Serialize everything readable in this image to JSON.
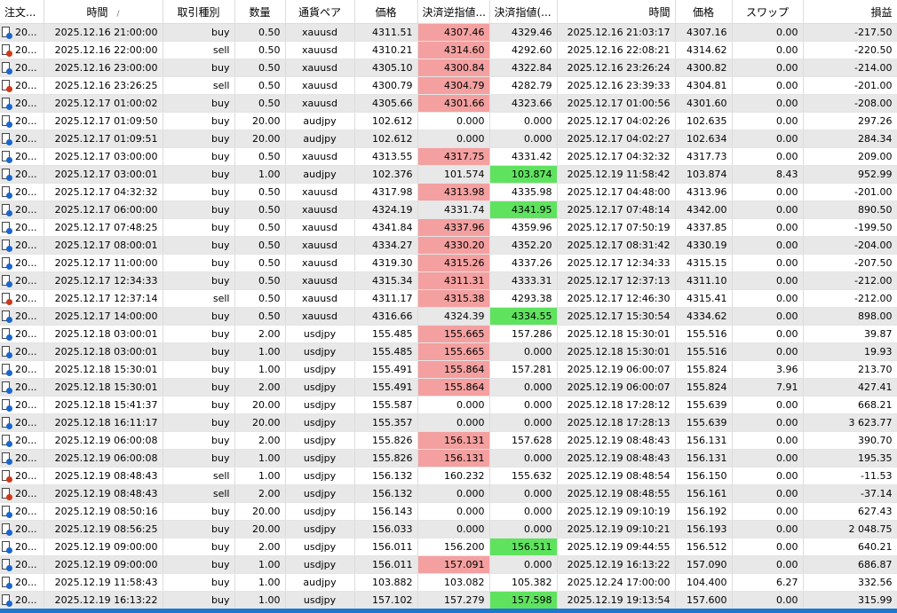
{
  "headers": [
    "注文...",
    "時間",
    "取引種別",
    "数量",
    "通貨ペア",
    "価格",
    "決済逆指値...",
    "決済指値(...",
    "時間",
    "価格",
    "スワップ",
    "損益"
  ],
  "sort_indicator": "/",
  "colors": {
    "stop_hit": "#f4a0a0",
    "tp_hit": "#5fe35f",
    "alt_row": "#e8e8e8",
    "selection": "#1e78d0"
  },
  "rows": [
    {
      "id": "20...",
      "open_time": "2025.12.16 21:00:00",
      "type": "buy",
      "volume": "0.50",
      "symbol": "xauusd",
      "open_price": "4311.51",
      "sl": "4307.46",
      "tp": "4329.46",
      "close_time": "2025.12.16 21:03:17",
      "close_price": "4307.16",
      "swap": "0.00",
      "profit": "-217.50",
      "hl": "sl"
    },
    {
      "id": "20...",
      "open_time": "2025.12.16 22:00:00",
      "type": "sell",
      "volume": "0.50",
      "symbol": "xauusd",
      "open_price": "4310.21",
      "sl": "4314.60",
      "tp": "4292.60",
      "close_time": "2025.12.16 22:08:21",
      "close_price": "4314.62",
      "swap": "0.00",
      "profit": "-220.50",
      "hl": "sl"
    },
    {
      "id": "20...",
      "open_time": "2025.12.16 23:00:00",
      "type": "buy",
      "volume": "0.50",
      "symbol": "xauusd",
      "open_price": "4305.10",
      "sl": "4300.84",
      "tp": "4322.84",
      "close_time": "2025.12.16 23:26:24",
      "close_price": "4300.82",
      "swap": "0.00",
      "profit": "-214.00",
      "hl": "sl"
    },
    {
      "id": "20...",
      "open_time": "2025.12.16 23:26:25",
      "type": "sell",
      "volume": "0.50",
      "symbol": "xauusd",
      "open_price": "4300.79",
      "sl": "4304.79",
      "tp": "4282.79",
      "close_time": "2025.12.16 23:39:33",
      "close_price": "4304.81",
      "swap": "0.00",
      "profit": "-201.00",
      "hl": "sl"
    },
    {
      "id": "20...",
      "open_time": "2025.12.17 01:00:02",
      "type": "buy",
      "volume": "0.50",
      "symbol": "xauusd",
      "open_price": "4305.66",
      "sl": "4301.66",
      "tp": "4323.66",
      "close_time": "2025.12.17 01:00:56",
      "close_price": "4301.60",
      "swap": "0.00",
      "profit": "-208.00",
      "hl": "sl"
    },
    {
      "id": "20...",
      "open_time": "2025.12.17 01:09:50",
      "type": "buy",
      "volume": "20.00",
      "symbol": "audjpy",
      "open_price": "102.612",
      "sl": "0.000",
      "tp": "0.000",
      "close_time": "2025.12.17 04:02:26",
      "close_price": "102.635",
      "swap": "0.00",
      "profit": "297.26",
      "hl": ""
    },
    {
      "id": "20...",
      "open_time": "2025.12.17 01:09:51",
      "type": "buy",
      "volume": "20.00",
      "symbol": "audjpy",
      "open_price": "102.612",
      "sl": "0.000",
      "tp": "0.000",
      "close_time": "2025.12.17 04:02:27",
      "close_price": "102.634",
      "swap": "0.00",
      "profit": "284.34",
      "hl": ""
    },
    {
      "id": "20...",
      "open_time": "2025.12.17 03:00:00",
      "type": "buy",
      "volume": "0.50",
      "symbol": "xauusd",
      "open_price": "4313.55",
      "sl": "4317.75",
      "tp": "4331.42",
      "close_time": "2025.12.17 04:32:32",
      "close_price": "4317.73",
      "swap": "0.00",
      "profit": "209.00",
      "hl": "sl"
    },
    {
      "id": "20...",
      "open_time": "2025.12.17 03:00:01",
      "type": "buy",
      "volume": "1.00",
      "symbol": "audjpy",
      "open_price": "102.376",
      "sl": "101.574",
      "tp": "103.874",
      "close_time": "2025.12.19 11:58:42",
      "close_price": "103.874",
      "swap": "8.43",
      "profit": "952.99",
      "hl": "tp"
    },
    {
      "id": "20...",
      "open_time": "2025.12.17 04:32:32",
      "type": "buy",
      "volume": "0.50",
      "symbol": "xauusd",
      "open_price": "4317.98",
      "sl": "4313.98",
      "tp": "4335.98",
      "close_time": "2025.12.17 04:48:00",
      "close_price": "4313.96",
      "swap": "0.00",
      "profit": "-201.00",
      "hl": "sl"
    },
    {
      "id": "20...",
      "open_time": "2025.12.17 06:00:00",
      "type": "buy",
      "volume": "0.50",
      "symbol": "xauusd",
      "open_price": "4324.19",
      "sl": "4331.74",
      "tp": "4341.95",
      "close_time": "2025.12.17 07:48:14",
      "close_price": "4342.00",
      "swap": "0.00",
      "profit": "890.50",
      "hl": "tp"
    },
    {
      "id": "20...",
      "open_time": "2025.12.17 07:48:25",
      "type": "buy",
      "volume": "0.50",
      "symbol": "xauusd",
      "open_price": "4341.84",
      "sl": "4337.96",
      "tp": "4359.96",
      "close_time": "2025.12.17 07:50:19",
      "close_price": "4337.85",
      "swap": "0.00",
      "profit": "-199.50",
      "hl": "sl"
    },
    {
      "id": "20...",
      "open_time": "2025.12.17 08:00:01",
      "type": "buy",
      "volume": "0.50",
      "symbol": "xauusd",
      "open_price": "4334.27",
      "sl": "4330.20",
      "tp": "4352.20",
      "close_time": "2025.12.17 08:31:42",
      "close_price": "4330.19",
      "swap": "0.00",
      "profit": "-204.00",
      "hl": "sl"
    },
    {
      "id": "20...",
      "open_time": "2025.12.17 11:00:00",
      "type": "buy",
      "volume": "0.50",
      "symbol": "xauusd",
      "open_price": "4319.30",
      "sl": "4315.26",
      "tp": "4337.26",
      "close_time": "2025.12.17 12:34:33",
      "close_price": "4315.15",
      "swap": "0.00",
      "profit": "-207.50",
      "hl": "sl"
    },
    {
      "id": "20...",
      "open_time": "2025.12.17 12:34:33",
      "type": "buy",
      "volume": "0.50",
      "symbol": "xauusd",
      "open_price": "4315.34",
      "sl": "4311.31",
      "tp": "4333.31",
      "close_time": "2025.12.17 12:37:13",
      "close_price": "4311.10",
      "swap": "0.00",
      "profit": "-212.00",
      "hl": "sl"
    },
    {
      "id": "20...",
      "open_time": "2025.12.17 12:37:14",
      "type": "sell",
      "volume": "0.50",
      "symbol": "xauusd",
      "open_price": "4311.17",
      "sl": "4315.38",
      "tp": "4293.38",
      "close_time": "2025.12.17 12:46:30",
      "close_price": "4315.41",
      "swap": "0.00",
      "profit": "-212.00",
      "hl": "sl"
    },
    {
      "id": "20...",
      "open_time": "2025.12.17 14:00:00",
      "type": "buy",
      "volume": "0.50",
      "symbol": "xauusd",
      "open_price": "4316.66",
      "sl": "4324.39",
      "tp": "4334.55",
      "close_time": "2025.12.17 15:30:54",
      "close_price": "4334.62",
      "swap": "0.00",
      "profit": "898.00",
      "hl": "tp"
    },
    {
      "id": "20...",
      "open_time": "2025.12.18 03:00:01",
      "type": "buy",
      "volume": "2.00",
      "symbol": "usdjpy",
      "open_price": "155.485",
      "sl": "155.665",
      "tp": "157.286",
      "close_time": "2025.12.18 15:30:01",
      "close_price": "155.516",
      "swap": "0.00",
      "profit": "39.87",
      "hl": "sl"
    },
    {
      "id": "20...",
      "open_time": "2025.12.18 03:00:01",
      "type": "buy",
      "volume": "1.00",
      "symbol": "usdjpy",
      "open_price": "155.485",
      "sl": "155.665",
      "tp": "0.000",
      "close_time": "2025.12.18 15:30:01",
      "close_price": "155.516",
      "swap": "0.00",
      "profit": "19.93",
      "hl": "sl"
    },
    {
      "id": "20...",
      "open_time": "2025.12.18 15:30:01",
      "type": "buy",
      "volume": "1.00",
      "symbol": "usdjpy",
      "open_price": "155.491",
      "sl": "155.864",
      "tp": "157.281",
      "close_time": "2025.12.19 06:00:07",
      "close_price": "155.824",
      "swap": "3.96",
      "profit": "213.70",
      "hl": "sl"
    },
    {
      "id": "20...",
      "open_time": "2025.12.18 15:30:01",
      "type": "buy",
      "volume": "2.00",
      "symbol": "usdjpy",
      "open_price": "155.491",
      "sl": "155.864",
      "tp": "0.000",
      "close_time": "2025.12.19 06:00:07",
      "close_price": "155.824",
      "swap": "7.91",
      "profit": "427.41",
      "hl": "sl"
    },
    {
      "id": "20...",
      "open_time": "2025.12.18 15:41:37",
      "type": "buy",
      "volume": "20.00",
      "symbol": "usdjpy",
      "open_price": "155.587",
      "sl": "0.000",
      "tp": "0.000",
      "close_time": "2025.12.18 17:28:12",
      "close_price": "155.639",
      "swap": "0.00",
      "profit": "668.21",
      "hl": ""
    },
    {
      "id": "20...",
      "open_time": "2025.12.18 16:11:17",
      "type": "buy",
      "volume": "20.00",
      "symbol": "usdjpy",
      "open_price": "155.357",
      "sl": "0.000",
      "tp": "0.000",
      "close_time": "2025.12.18 17:28:13",
      "close_price": "155.639",
      "swap": "0.00",
      "profit": "3 623.77",
      "hl": ""
    },
    {
      "id": "20...",
      "open_time": "2025.12.19 06:00:08",
      "type": "buy",
      "volume": "2.00",
      "symbol": "usdjpy",
      "open_price": "155.826",
      "sl": "156.131",
      "tp": "157.628",
      "close_time": "2025.12.19 08:48:43",
      "close_price": "156.131",
      "swap": "0.00",
      "profit": "390.70",
      "hl": "sl"
    },
    {
      "id": "20...",
      "open_time": "2025.12.19 06:00:08",
      "type": "buy",
      "volume": "1.00",
      "symbol": "usdjpy",
      "open_price": "155.826",
      "sl": "156.131",
      "tp": "0.000",
      "close_time": "2025.12.19 08:48:43",
      "close_price": "156.131",
      "swap": "0.00",
      "profit": "195.35",
      "hl": "sl"
    },
    {
      "id": "20...",
      "open_time": "2025.12.19 08:48:43",
      "type": "sell",
      "volume": "1.00",
      "symbol": "usdjpy",
      "open_price": "156.132",
      "sl": "160.232",
      "tp": "155.632",
      "close_time": "2025.12.19 08:48:54",
      "close_price": "156.150",
      "swap": "0.00",
      "profit": "-11.53",
      "hl": ""
    },
    {
      "id": "20...",
      "open_time": "2025.12.19 08:48:43",
      "type": "sell",
      "volume": "2.00",
      "symbol": "usdjpy",
      "open_price": "156.132",
      "sl": "0.000",
      "tp": "0.000",
      "close_time": "2025.12.19 08:48:55",
      "close_price": "156.161",
      "swap": "0.00",
      "profit": "-37.14",
      "hl": ""
    },
    {
      "id": "20...",
      "open_time": "2025.12.19 08:50:16",
      "type": "buy",
      "volume": "20.00",
      "symbol": "usdjpy",
      "open_price": "156.143",
      "sl": "0.000",
      "tp": "0.000",
      "close_time": "2025.12.19 09:10:19",
      "close_price": "156.192",
      "swap": "0.00",
      "profit": "627.43",
      "hl": ""
    },
    {
      "id": "20...",
      "open_time": "2025.12.19 08:56:25",
      "type": "buy",
      "volume": "20.00",
      "symbol": "usdjpy",
      "open_price": "156.033",
      "sl": "0.000",
      "tp": "0.000",
      "close_time": "2025.12.19 09:10:21",
      "close_price": "156.193",
      "swap": "0.00",
      "profit": "2 048.75",
      "hl": ""
    },
    {
      "id": "20...",
      "open_time": "2025.12.19 09:00:00",
      "type": "buy",
      "volume": "2.00",
      "symbol": "usdjpy",
      "open_price": "156.011",
      "sl": "156.200",
      "tp": "156.511",
      "close_time": "2025.12.19 09:44:55",
      "close_price": "156.512",
      "swap": "0.00",
      "profit": "640.21",
      "hl": "tp"
    },
    {
      "id": "20...",
      "open_time": "2025.12.19 09:00:00",
      "type": "buy",
      "volume": "1.00",
      "symbol": "usdjpy",
      "open_price": "156.011",
      "sl": "157.091",
      "tp": "0.000",
      "close_time": "2025.12.19 16:13:22",
      "close_price": "157.090",
      "swap": "0.00",
      "profit": "686.87",
      "hl": "sl"
    },
    {
      "id": "20...",
      "open_time": "2025.12.19 11:58:43",
      "type": "buy",
      "volume": "1.00",
      "symbol": "audjpy",
      "open_price": "103.882",
      "sl": "103.082",
      "tp": "105.382",
      "close_time": "2025.12.24 17:00:00",
      "close_price": "104.400",
      "swap": "6.27",
      "profit": "332.56",
      "hl": ""
    },
    {
      "id": "20...",
      "open_time": "2025.12.19 16:13:22",
      "type": "buy",
      "volume": "1.00",
      "symbol": "usdjpy",
      "open_price": "157.102",
      "sl": "157.279",
      "tp": "157.598",
      "close_time": "2025.12.19 19:13:54",
      "close_price": "157.600",
      "swap": "0.00",
      "profit": "315.99",
      "hl": "tp"
    }
  ]
}
